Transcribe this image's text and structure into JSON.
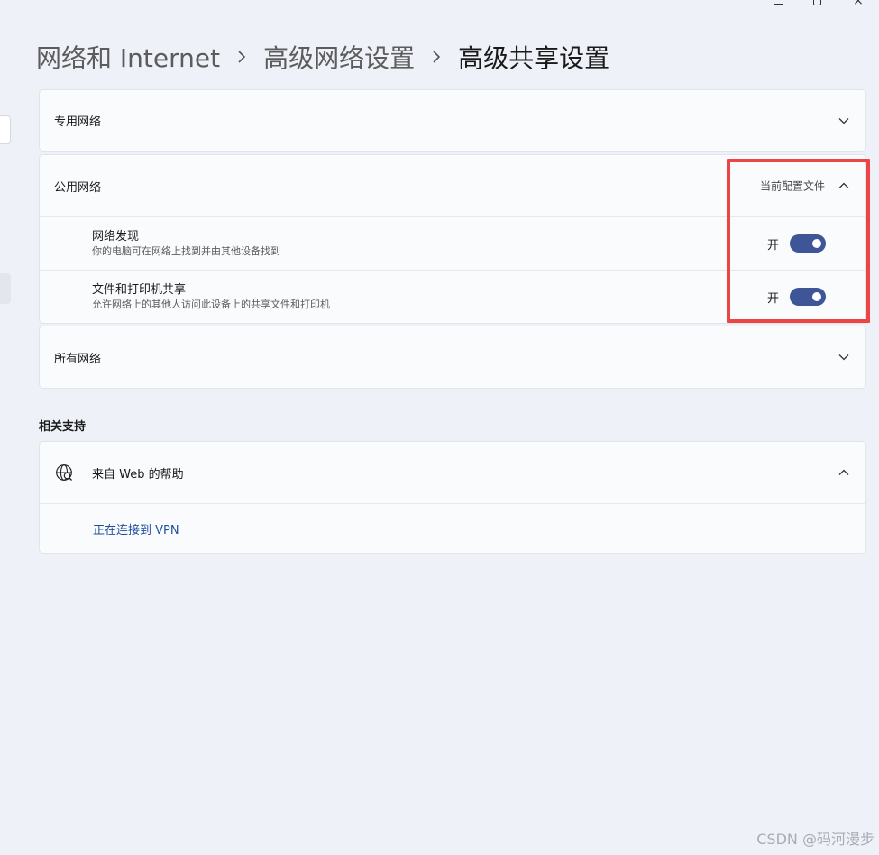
{
  "window": {
    "controls": {
      "close_glyph": "×"
    }
  },
  "breadcrumb": [
    {
      "label": "网络和 Internet"
    },
    {
      "label": "高级网络设置"
    },
    {
      "label": "高级共享设置"
    }
  ],
  "sections": {
    "private": {
      "title": "专用网络",
      "expanded": false,
      "icon": "chevron-down-icon"
    },
    "public": {
      "title": "公用网络",
      "tag": "当前配置文件",
      "expanded": true,
      "icon": "chevron-up-icon",
      "settings": [
        {
          "title": "网络发现",
          "description": "你的电脑可在网络上找到并由其他设备找到",
          "state_label": "开",
          "on": true
        },
        {
          "title": "文件和打印机共享",
          "description": "允许网络上的其他人访问此设备上的共享文件和打印机",
          "state_label": "开",
          "on": true
        }
      ]
    },
    "all": {
      "title": "所有网络",
      "expanded": false,
      "icon": "chevron-down-icon"
    }
  },
  "related_support": {
    "heading": "相关支持",
    "help_title": "来自 Web 的帮助",
    "help_icon": "globe-search-icon",
    "links": [
      "正在连接到 VPN"
    ]
  },
  "colors": {
    "toggle_on": "#3e5597",
    "annotation": "#ef4444",
    "link": "#1e4f9e"
  },
  "watermark": "CSDN @码河漫步"
}
